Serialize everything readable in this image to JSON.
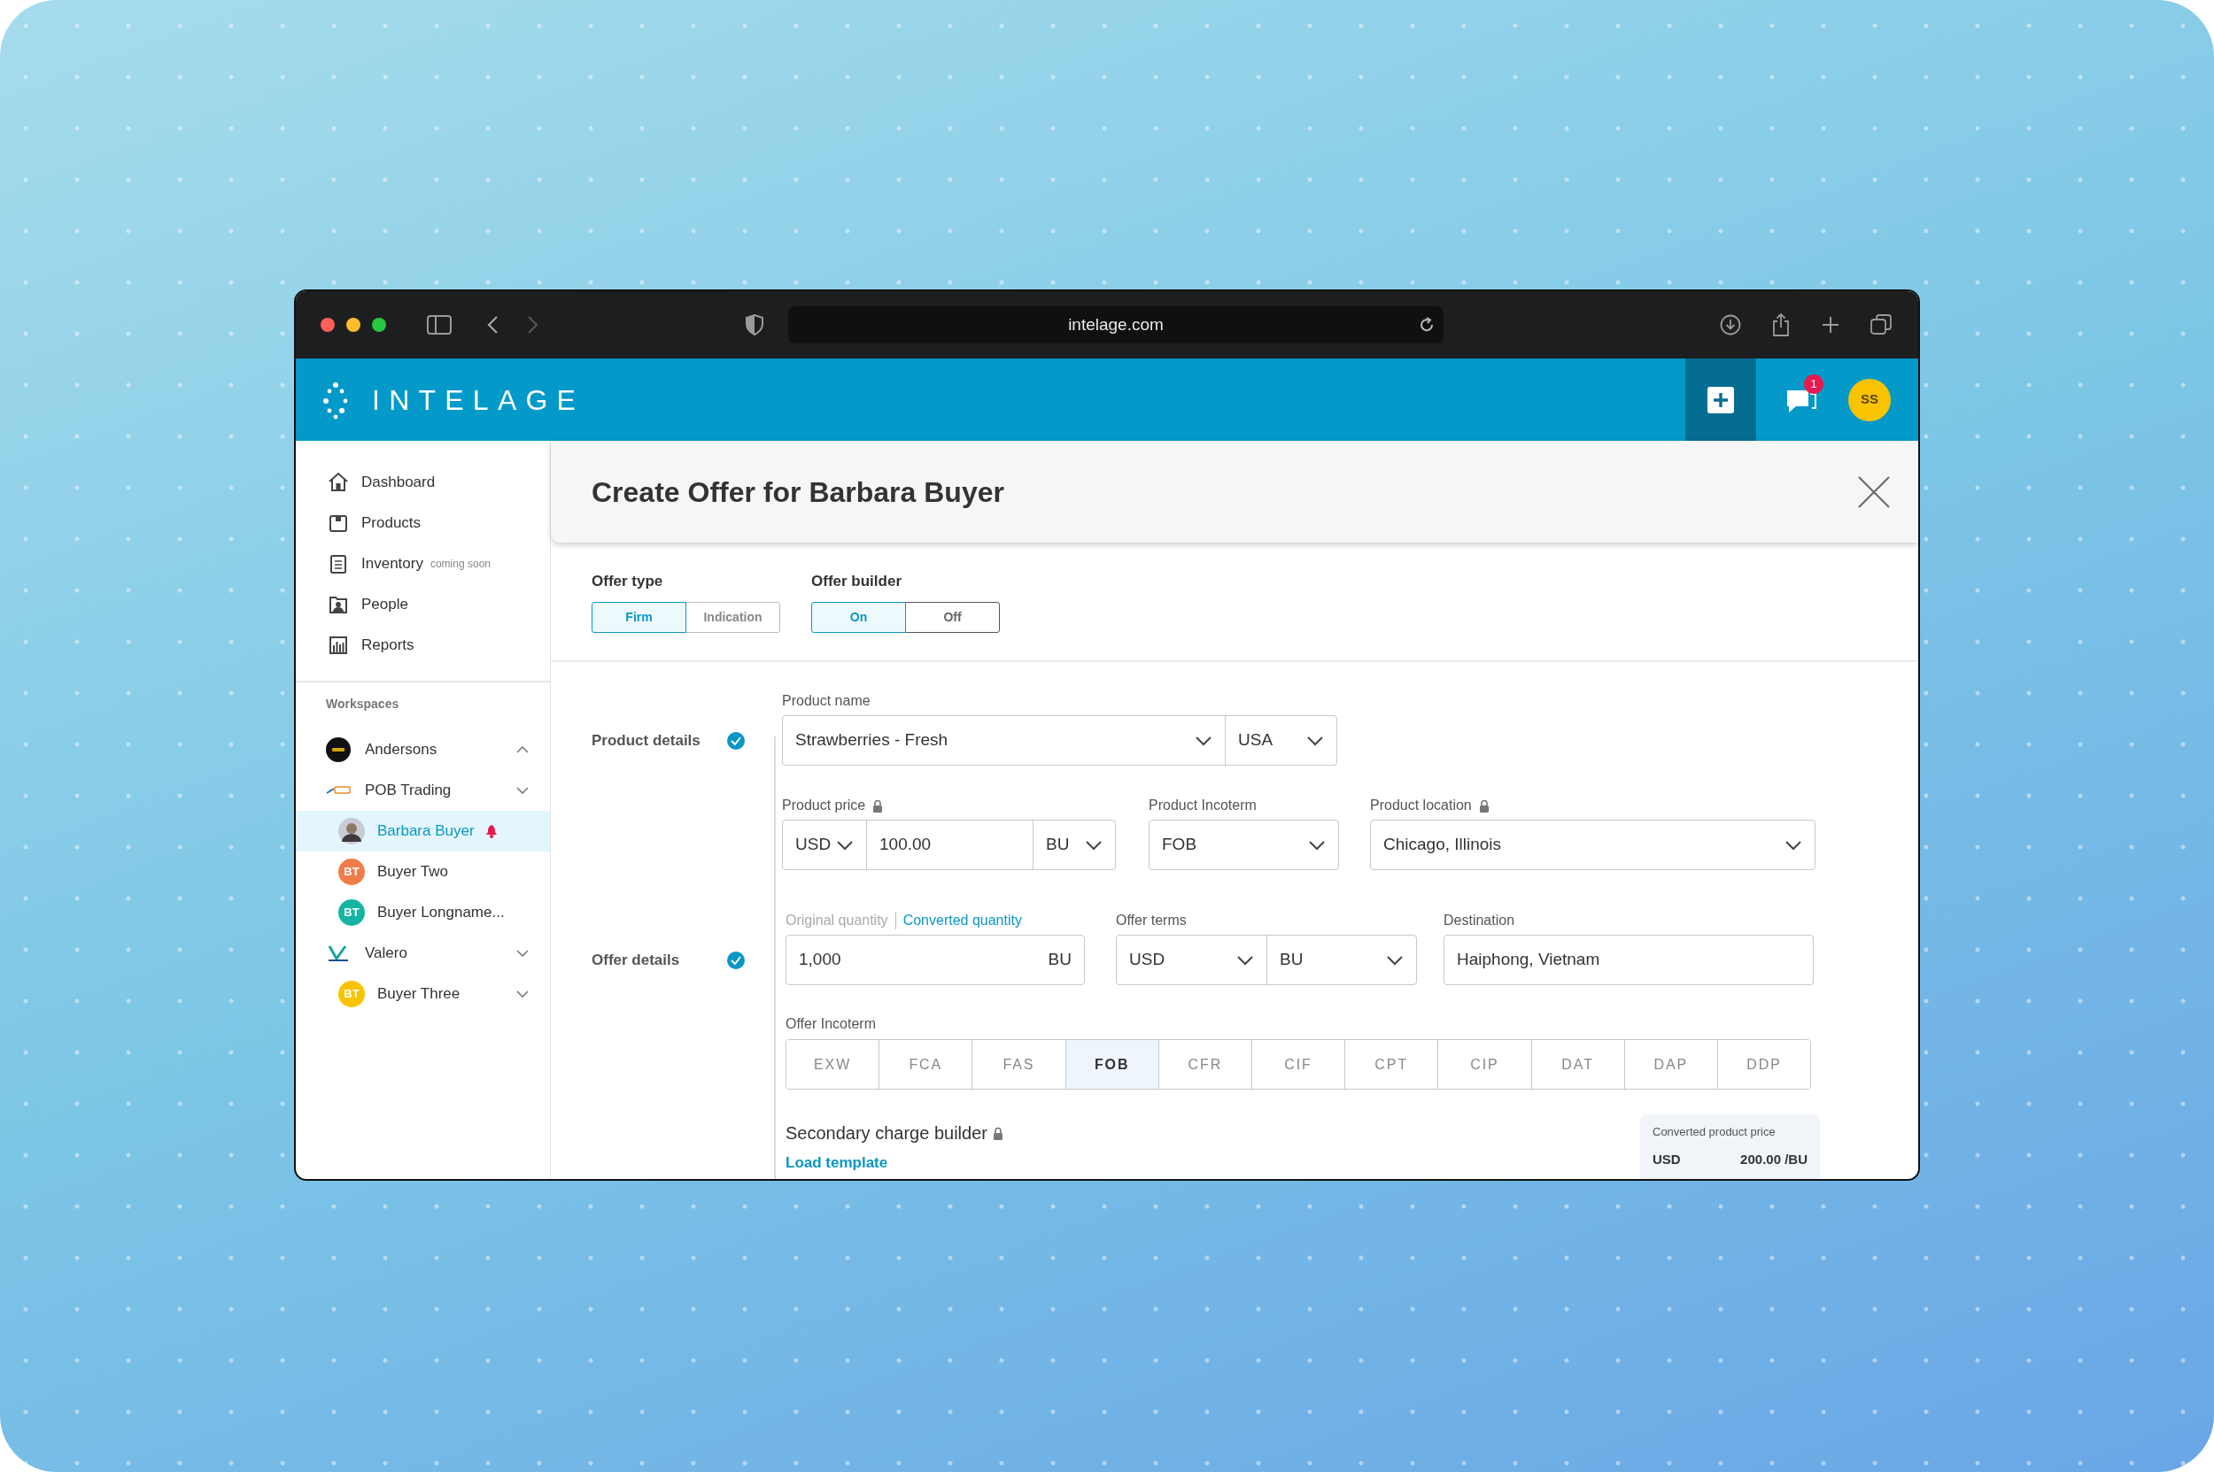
{
  "browser": {
    "url": "intelage.com"
  },
  "app": {
    "logo_text": "INTELAGE",
    "notification_count": "1",
    "avatar_initials": "SS"
  },
  "sidebar": {
    "nav": [
      {
        "label": "Dashboard",
        "kind": "home"
      },
      {
        "label": "Products",
        "kind": "box"
      },
      {
        "label": "Inventory",
        "kind": "clipboard",
        "note": "coming soon"
      },
      {
        "label": "People",
        "kind": "person"
      },
      {
        "label": "Reports",
        "kind": "chart"
      }
    ],
    "workspaces_heading": "Workspaces",
    "workspaces": [
      {
        "label": "Andersons",
        "kind": "disc",
        "expanded": true
      },
      {
        "label": "POB Trading",
        "kind": "wordmark",
        "expanded": false,
        "children": [
          {
            "label": "Barbara Buyer",
            "kind": "photo",
            "selected": true,
            "alert": true
          },
          {
            "label": "Buyer Two",
            "kind": "initials",
            "initials": "BT",
            "color": "#f07c4b",
            "selected": false,
            "alert": false
          },
          {
            "label": "Buyer Longname...",
            "kind": "initials",
            "initials": "BT",
            "color": "#17b5a1",
            "selected": false,
            "alert": false
          }
        ]
      },
      {
        "label": "Valero",
        "kind": "vmark",
        "expanded": false,
        "children": [
          {
            "label": "Buyer Three",
            "kind": "initials",
            "initials": "BT",
            "color": "#f8c300",
            "selected": false,
            "alert": false,
            "expanded": false
          }
        ]
      }
    ]
  },
  "panel": {
    "title": "Create Offer for Barbara Buyer",
    "toggles": [
      {
        "label": "Offer type",
        "options": [
          {
            "label": "Firm",
            "selected": true
          },
          {
            "label": "Indication",
            "selected": false
          }
        ]
      },
      {
        "label": "Offer builder",
        "options": [
          {
            "label": "On",
            "selected": true
          },
          {
            "label": "Off",
            "selected": false
          }
        ]
      }
    ],
    "rows": [
      {
        "step": {
          "label": "Product details",
          "done": true
        },
        "fields": [
          {
            "label": "Product name",
            "segments": [
              {
                "kind": "select",
                "value": "Strawberries - Fresh"
              },
              {
                "kind": "select",
                "value": "USA"
              }
            ]
          }
        ]
      },
      {
        "fields": [
          {
            "label": "Product price",
            "locked": true,
            "segments": [
              {
                "kind": "select",
                "value": "USD"
              },
              {
                "kind": "text",
                "value": "100.00"
              },
              {
                "kind": "select",
                "value": "BU"
              }
            ]
          },
          {
            "label": "Product Incoterm",
            "segments": [
              {
                "kind": "select",
                "value": "FOB"
              }
            ]
          },
          {
            "label": "Product location",
            "locked": true,
            "segments": [
              {
                "kind": "select",
                "value": "Chicago, Illinois"
              }
            ]
          }
        ]
      },
      {
        "step": {
          "label": "Offer details",
          "done": true
        },
        "fields": [
          {
            "label_options": [
              {
                "label": "Original quantity",
                "selected": false
              },
              {
                "label": "Converted quantity",
                "selected": true
              }
            ],
            "segments": [
              {
                "kind": "text",
                "value": "1,000"
              },
              {
                "kind": "suffix",
                "value": "BU"
              }
            ]
          },
          {
            "label": "Offer terms",
            "segments": [
              {
                "kind": "select",
                "value": "USD"
              },
              {
                "kind": "select",
                "value": "BU"
              }
            ]
          },
          {
            "label": "Destination",
            "segments": [
              {
                "kind": "text",
                "value": "Haiphong, Vietnam"
              }
            ]
          }
        ]
      }
    ],
    "incoterm": {
      "label": "Offer Incoterm",
      "options": [
        {
          "label": "EXW",
          "selected": false
        },
        {
          "label": "FCA",
          "selected": false
        },
        {
          "label": "FAS",
          "selected": false
        },
        {
          "label": "FOB",
          "selected": true
        },
        {
          "label": "CFR",
          "selected": false
        },
        {
          "label": "CIF",
          "selected": false
        },
        {
          "label": "CPT",
          "selected": false
        },
        {
          "label": "CIP",
          "selected": false
        },
        {
          "label": "DAT",
          "selected": false
        },
        {
          "label": "DAP",
          "selected": false
        },
        {
          "label": "DDP",
          "selected": false
        }
      ]
    },
    "secondary": {
      "label": "Secondary charge builder",
      "locked": true,
      "link": "Load template"
    },
    "converted_price": {
      "label": "Converted product price",
      "currency": "USD",
      "value": "200.00 /BU"
    }
  }
}
